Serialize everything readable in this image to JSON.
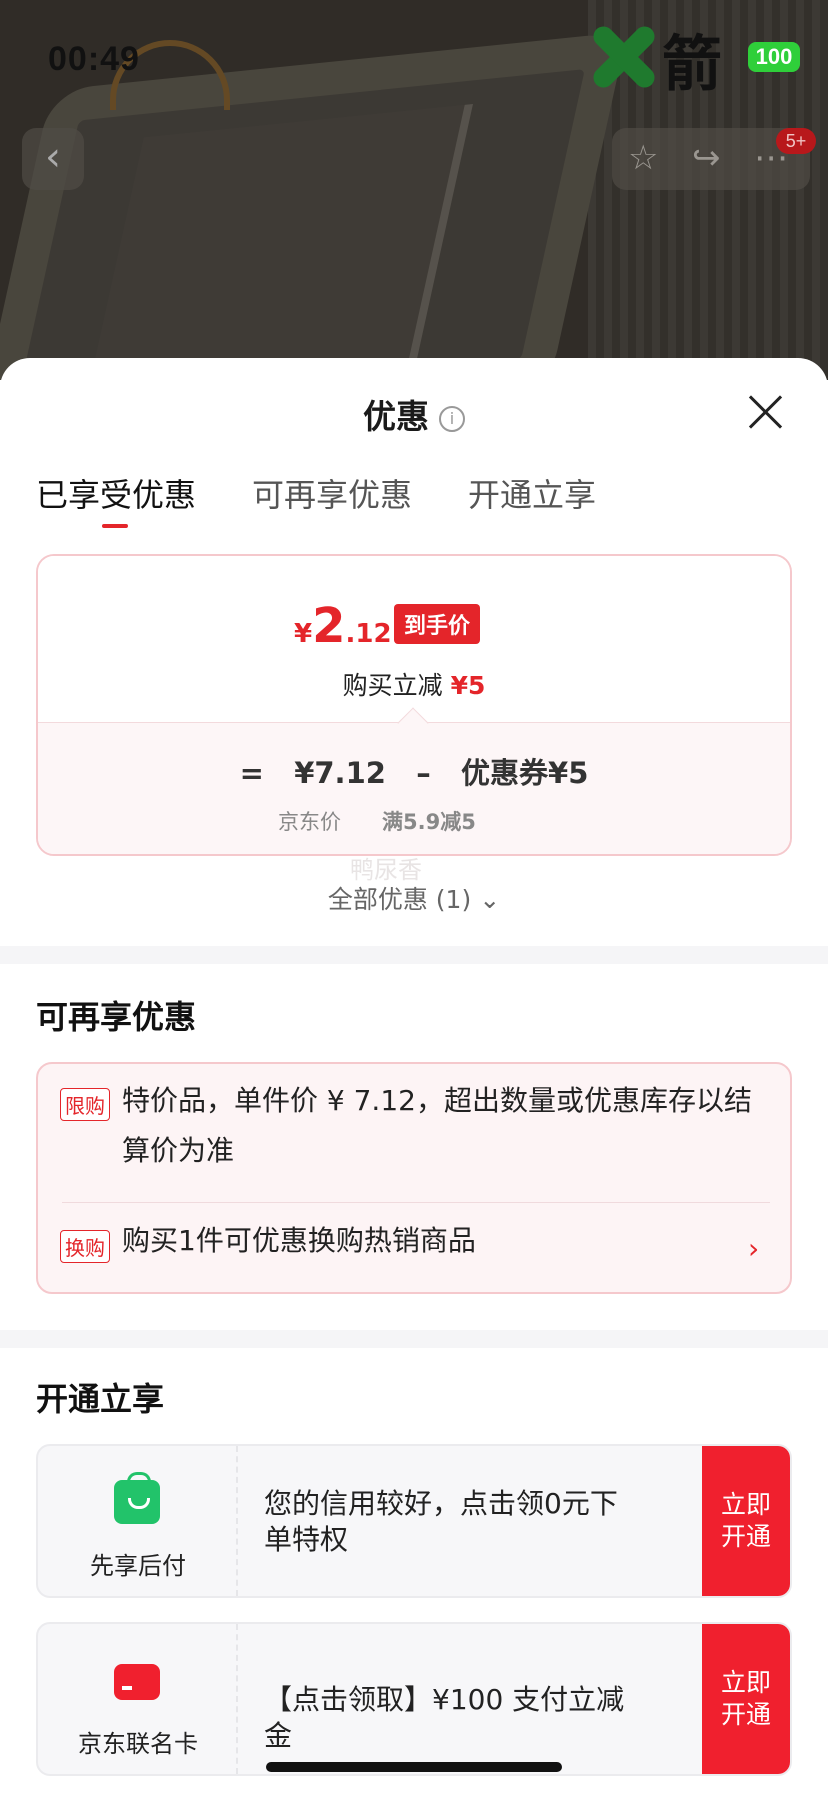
{
  "status": {
    "time": "00:49",
    "battery": "100",
    "watermark": "箭"
  },
  "nav": {
    "back_icon": "chevron-left",
    "notification_count": "5+"
  },
  "sheet": {
    "title": "优惠",
    "tabs": [
      {
        "label": "已享受优惠",
        "active": true
      },
      {
        "label": "可再享优惠",
        "active": false
      },
      {
        "label": "开通立享",
        "active": false
      }
    ]
  },
  "price_card": {
    "currency": "¥",
    "price_int": "2",
    "price_dec": ".12",
    "tag": "到手价",
    "sub_label": "购买立减",
    "sub_value": "¥5",
    "equals": "=",
    "base_price": "¥7.12",
    "minus": "–",
    "coupon": "优惠券¥5",
    "base_label": "京东价",
    "coupon_label": "满5.9减5",
    "faint_watermark": "鸭尿香"
  },
  "all_promo": "全部优惠 (1)",
  "more_section": {
    "title": "可再享优惠",
    "items": [
      {
        "tag": "限购",
        "text": "特价品，单件价 ¥ 7.12，超出数量或优惠库存以结算价为准"
      },
      {
        "tag": "换购",
        "text": "购买1件可优惠换购热销商品"
      }
    ]
  },
  "open_section": {
    "title": "开通立享",
    "cards": [
      {
        "icon": "shopping-bag-icon",
        "label": "先享后付",
        "desc": "您的信用较好，点击领0元下单特权",
        "cta": "立即开通"
      },
      {
        "icon": "credit-card-icon",
        "label": "京东联名卡",
        "desc": "【点击领取】¥100 支付立减金",
        "cta": "立即开通"
      }
    ]
  }
}
